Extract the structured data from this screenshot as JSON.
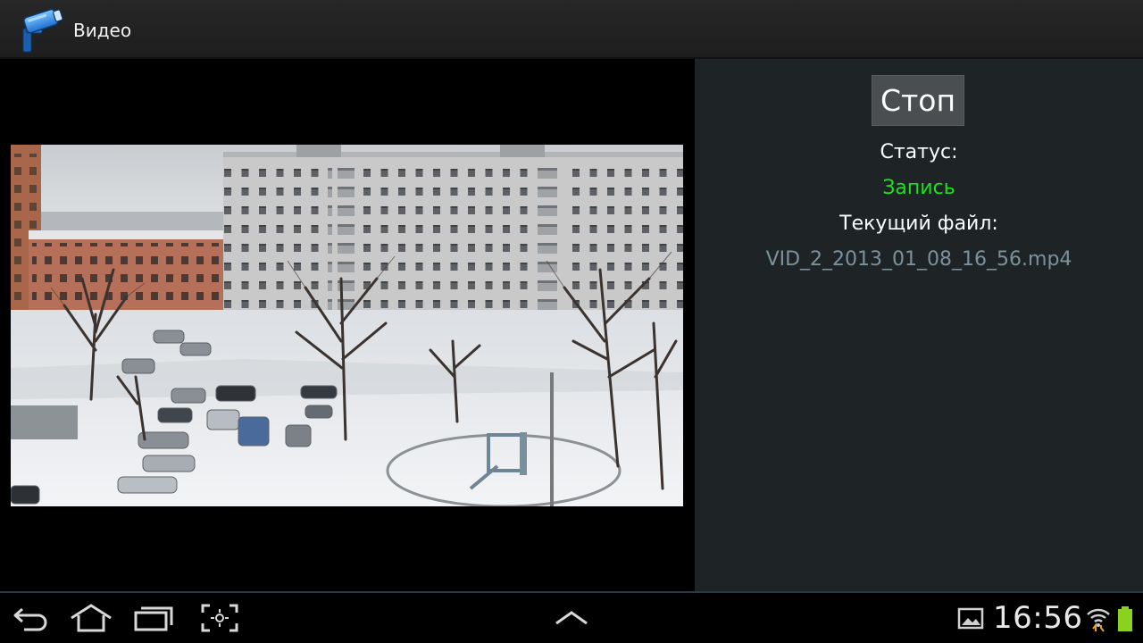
{
  "app": {
    "title": "Видео",
    "icon": "security-camera-icon"
  },
  "video": {
    "scene": "snowy-courtyard-camera-feed"
  },
  "panel": {
    "stop_label": "Стоп",
    "status_label": "Статус:",
    "status_value": "Запись",
    "current_file_label": "Текущий файл:",
    "current_file_value": "VID_2_2013_01_08_16_56.mp4"
  },
  "navbar": {
    "buttons": [
      "back-icon",
      "home-icon",
      "recent-apps-icon",
      "screenshot-icon",
      "chevron-up-icon"
    ],
    "time": "16:56",
    "status_icons": [
      "gallery-notification-icon",
      "wifi-icon",
      "battery-icon"
    ]
  },
  "colors": {
    "status_recording": "#1ee01e",
    "filename": "#7c919b",
    "panel_bg": "#1e2426",
    "battery": "#8ad21f"
  }
}
